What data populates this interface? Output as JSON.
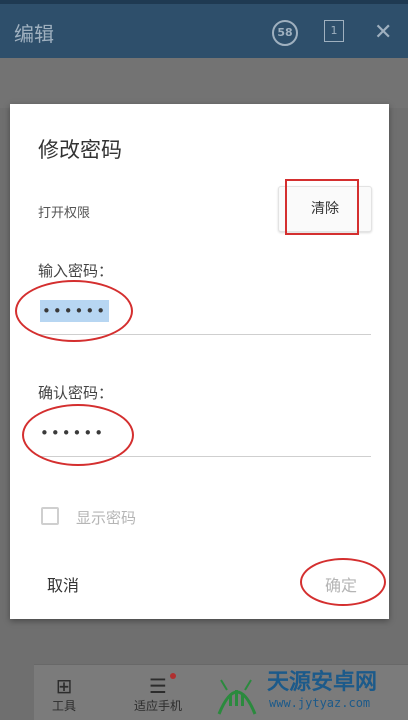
{
  "header": {
    "title": "编辑",
    "badge_58": "58",
    "page_1": "1",
    "close_glyph": "✕"
  },
  "bottom_toolbar": {
    "items": [
      {
        "label": "工具",
        "glyph": "⊞"
      },
      {
        "label": "适应手机",
        "glyph": "☰"
      }
    ]
  },
  "dialog": {
    "title": "修改密码",
    "permission_label": "打开权限",
    "clear_button": "清除",
    "password_label": "输入密码：",
    "password_value": "••••••",
    "confirm_label": "确认密码：",
    "confirm_value": "••••••",
    "show_password_label": "显示密码",
    "show_password_checked": false,
    "cancel_button": "取消",
    "ok_button": "确定"
  },
  "watermark": {
    "name": "天源安卓网",
    "url": "www.jytyaz.com"
  },
  "colors": {
    "annotation_red": "#d42f2f",
    "header_bg": "#2e4f6b",
    "selection": "#b7d6f2"
  }
}
